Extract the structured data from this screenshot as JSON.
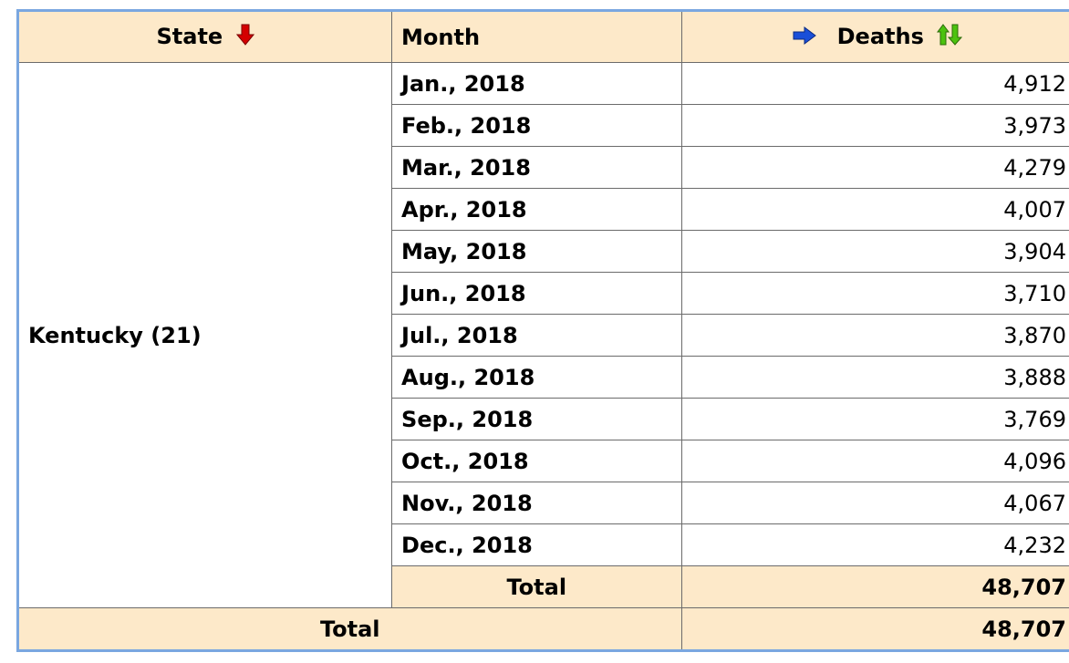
{
  "table": {
    "headers": {
      "state": "State",
      "month": "Month",
      "deaths": "Deaths"
    },
    "icons": {
      "state_sort": "sort-descending-arrow-icon",
      "deaths_measure": "measure-pointer-arrow-icon",
      "deaths_sort": "sort-up-down-arrows-icon"
    },
    "colors": {
      "header_bg": "#fde9c9",
      "frame_border": "#7aa7e0",
      "deaths_header_text": "#1744a8",
      "red_arrow": "#d40000",
      "green_arrow": "#4cc20f",
      "blue_arrow": "#1a4fd8"
    },
    "state_label": "Kentucky (21)",
    "rows": [
      {
        "month": "Jan., 2018",
        "deaths": "4,912"
      },
      {
        "month": "Feb., 2018",
        "deaths": "3,973"
      },
      {
        "month": "Mar., 2018",
        "deaths": "4,279"
      },
      {
        "month": "Apr., 2018",
        "deaths": "4,007"
      },
      {
        "month": "May, 2018",
        "deaths": "3,904"
      },
      {
        "month": "Jun., 2018",
        "deaths": "3,710"
      },
      {
        "month": "Jul., 2018",
        "deaths": "3,870"
      },
      {
        "month": "Aug., 2018",
        "deaths": "3,888"
      },
      {
        "month": "Sep., 2018",
        "deaths": "3,769"
      },
      {
        "month": "Oct., 2018",
        "deaths": "4,096"
      },
      {
        "month": "Nov., 2018",
        "deaths": "4,067"
      },
      {
        "month": "Dec., 2018",
        "deaths": "4,232"
      }
    ],
    "subtotal": {
      "label": "Total",
      "value": "48,707"
    },
    "grand_total": {
      "label": "Total",
      "value": "48,707"
    }
  }
}
